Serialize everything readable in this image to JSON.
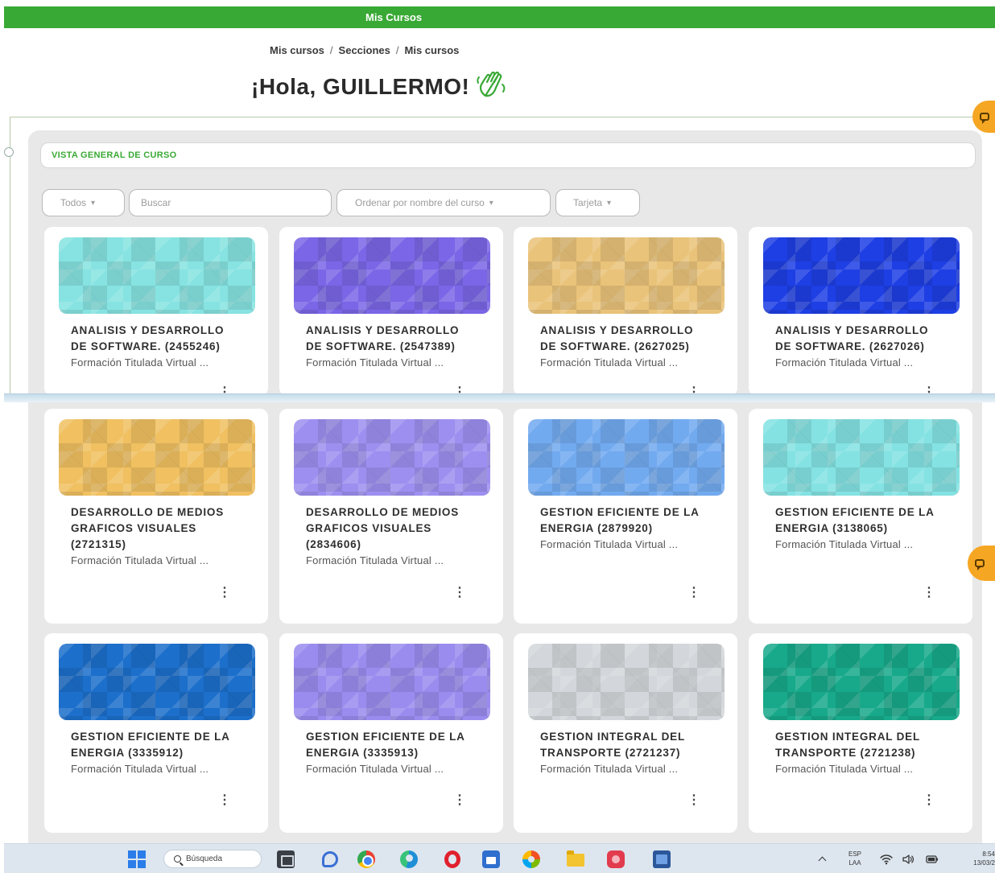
{
  "header": {
    "title": "Mis Cursos"
  },
  "breadcrumb": {
    "items": [
      "Mis cursos",
      "Secciones",
      "Mis cursos"
    ],
    "separator": "/"
  },
  "greeting": {
    "text": "¡Hola, GUILLERMO!",
    "icon": "waving-hand-icon"
  },
  "overview": {
    "title": "VISTA GENERAL DE CURSO",
    "filters": {
      "grouping": "Todos",
      "search_placeholder": "Buscar",
      "sort": "Ordenar por nombre del curso",
      "view": "Tarjeta"
    },
    "courses": [
      {
        "title_lines": [
          "ANALISIS Y DESARROLLO",
          "DE SOFTWARE. (2455246)"
        ],
        "category": "Formación Titulada Virtual ...",
        "color": "#86e3e1"
      },
      {
        "title_lines": [
          "ANALISIS Y DESARROLLO",
          "DE SOFTWARE. (2547389)"
        ],
        "category": "Formación Titulada Virtual ...",
        "color": "#7a66e6"
      },
      {
        "title_lines": [
          "ANALISIS Y DESARROLLO",
          "DE SOFTWARE. (2627025)"
        ],
        "category": "Formación Titulada Virtual ...",
        "color": "#e9c379"
      },
      {
        "title_lines": [
          "ANALISIS Y DESARROLLO",
          "DE SOFTWARE. (2627026)"
        ],
        "category": "Formación Titulada Virtual ...",
        "color": "#1e3fe4"
      },
      {
        "title_lines": [
          "DESARROLLO DE MEDIOS",
          "GRAFICOS VISUALES",
          "(2721315)"
        ],
        "category": "Formación Titulada Virtual ...",
        "color": "#f0c061"
      },
      {
        "title_lines": [
          "DESARROLLO DE MEDIOS",
          "GRAFICOS VISUALES",
          "(2834606)"
        ],
        "category": "Formación Titulada Virtual ...",
        "color": "#9d8ff0"
      },
      {
        "title_lines": [
          "GESTION EFICIENTE DE LA",
          "ENERGIA (2879920)"
        ],
        "category": "Formación Titulada Virtual ...",
        "color": "#72aaf0"
      },
      {
        "title_lines": [
          "GESTION EFICIENTE DE LA",
          "ENERGIA (3138065)"
        ],
        "category": "Formación Titulada Virtual ...",
        "color": "#84e2e2"
      },
      {
        "title_lines": [
          "GESTION EFICIENTE DE LA",
          "ENERGIA (3335912)"
        ],
        "category": "Formación Titulada Virtual ...",
        "color": "#1c6fcb"
      },
      {
        "title_lines": [
          "GESTION EFICIENTE DE LA",
          "ENERGIA (3335913)"
        ],
        "category": "Formación Titulada Virtual ...",
        "color": "#9a8cef"
      },
      {
        "title_lines": [
          "GESTION INTEGRAL DEL",
          "TRANSPORTE (2721237)"
        ],
        "category": "Formación Titulada Virtual ...",
        "color": "#d3d7db"
      },
      {
        "title_lines": [
          "GESTION INTEGRAL DEL",
          "TRANSPORTE (2721238)"
        ],
        "category": "Formación Titulada Virtual ...",
        "color": "#17a98a"
      }
    ]
  },
  "side_buttons": {
    "icon": "chat-icon"
  },
  "taskbar": {
    "start_icon": "windows-logo-icon",
    "search_placeholder": "Búsqueda",
    "apps": [
      "task-view-icon",
      "chat-icon",
      "chrome-icon",
      "edge-icon",
      "opera-icon",
      "store-icon",
      "photos-icon",
      "file-explorer-icon",
      "app-icon",
      "word-icon"
    ],
    "tray": {
      "language": "ESP",
      "keyboard": "LAA",
      "time": "8:54",
      "date": "13/03/2"
    }
  },
  "colors": {
    "brand_green": "#39a935",
    "accent_orange": "#f5a623",
    "panel_gray": "#e8e8e8"
  }
}
